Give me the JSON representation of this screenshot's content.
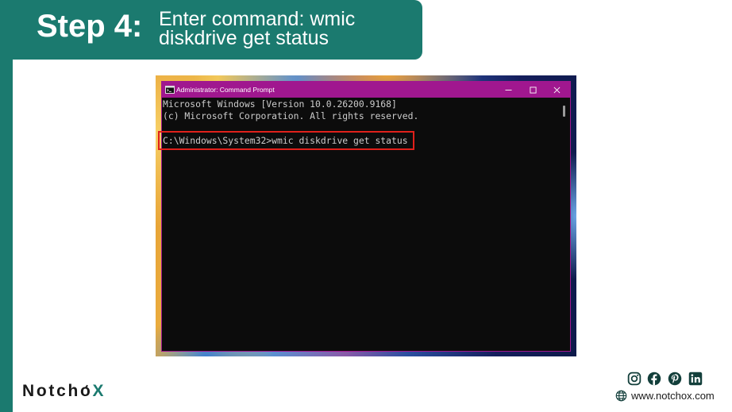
{
  "header": {
    "step_label": "Step 4:",
    "instruction": "Enter command: wmic diskdrive get status"
  },
  "command_prompt": {
    "title": "Administrator: Command Prompt",
    "title_icon": "cmd-icon",
    "controls": [
      "minimize-icon",
      "maximize-icon",
      "close-icon"
    ],
    "console": {
      "version_line": "Microsoft Windows [Version 10.0.26200.9168]",
      "copyright_line": "(c) Microsoft Corporation. All rights reserved.",
      "prompt": "C:\\Windows\\System32>",
      "command": "wmic diskdrive get status"
    }
  },
  "brand": {
    "logo": {
      "part1": "Notch",
      "clock_letter": "o",
      "part2": "X"
    },
    "social_icons": [
      "instagram-icon",
      "facebook-icon",
      "pinterest-icon",
      "linkedin-icon"
    ],
    "website_icon": "globe-icon",
    "website": "www.notchox.com"
  },
  "colors": {
    "brand_teal": "#1b7a6f",
    "titlebar": "#a0178f",
    "console_bg": "#0c0c0c",
    "console_text": "#cccccc",
    "highlight": "#e0201b",
    "icon_dark": "#133f3b"
  }
}
